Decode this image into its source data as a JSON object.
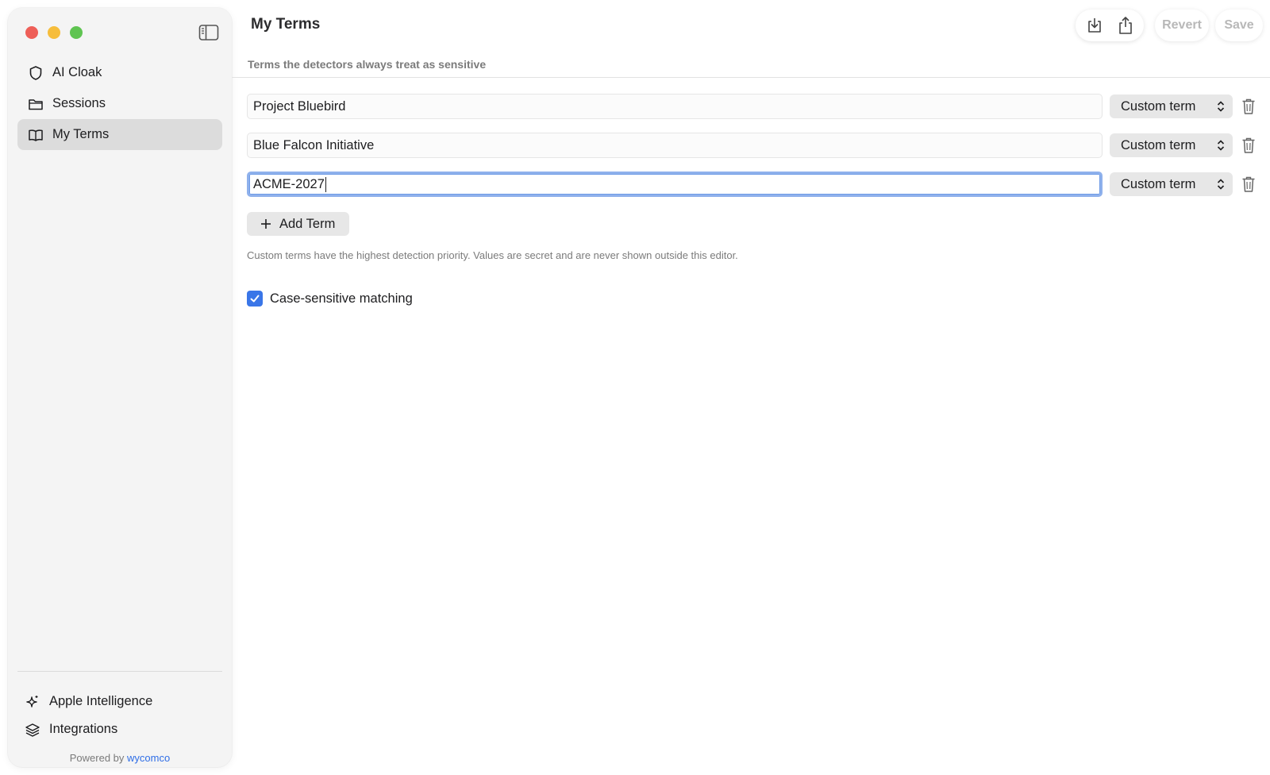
{
  "app": {
    "title": "My Terms",
    "subtitle": "Terms the detectors always treat as sensitive"
  },
  "sidebar": {
    "items": [
      {
        "label": "AI Cloak",
        "icon": "shield-icon",
        "active": false
      },
      {
        "label": "Sessions",
        "icon": "folder-icon",
        "active": false
      },
      {
        "label": "My Terms",
        "icon": "book-icon",
        "active": true
      }
    ],
    "bottom_items": [
      {
        "label": "Apple Intelligence",
        "icon": "sparkle-icon"
      },
      {
        "label": "Integrations",
        "icon": "layers-icon"
      }
    ],
    "powered_prefix": "Powered by",
    "powered_link": "wycomco"
  },
  "toolbar": {
    "import_icon": "import-icon",
    "share_icon": "share-icon",
    "revert_label": "Revert",
    "save_label": "Save"
  },
  "terms": [
    {
      "value": "Project Bluebird",
      "kind": "Custom term",
      "focused": false
    },
    {
      "value": "Blue Falcon Initiative",
      "kind": "Custom term",
      "focused": false
    },
    {
      "value": "ACME-2027",
      "kind": "Custom term",
      "focused": true
    }
  ],
  "add_term_label": "Add Term",
  "help_text": "Custom terms have the highest detection priority. Values are secret and are never shown outside this editor.",
  "case_sensitive": {
    "label": "Case-sensitive matching",
    "checked": true
  },
  "colors": {
    "accent": "#3a76e8",
    "link": "#2f6ee6",
    "traffic_red": "#ee5f58",
    "traffic_yellow": "#f6bd3b",
    "traffic_green": "#5fc451"
  }
}
